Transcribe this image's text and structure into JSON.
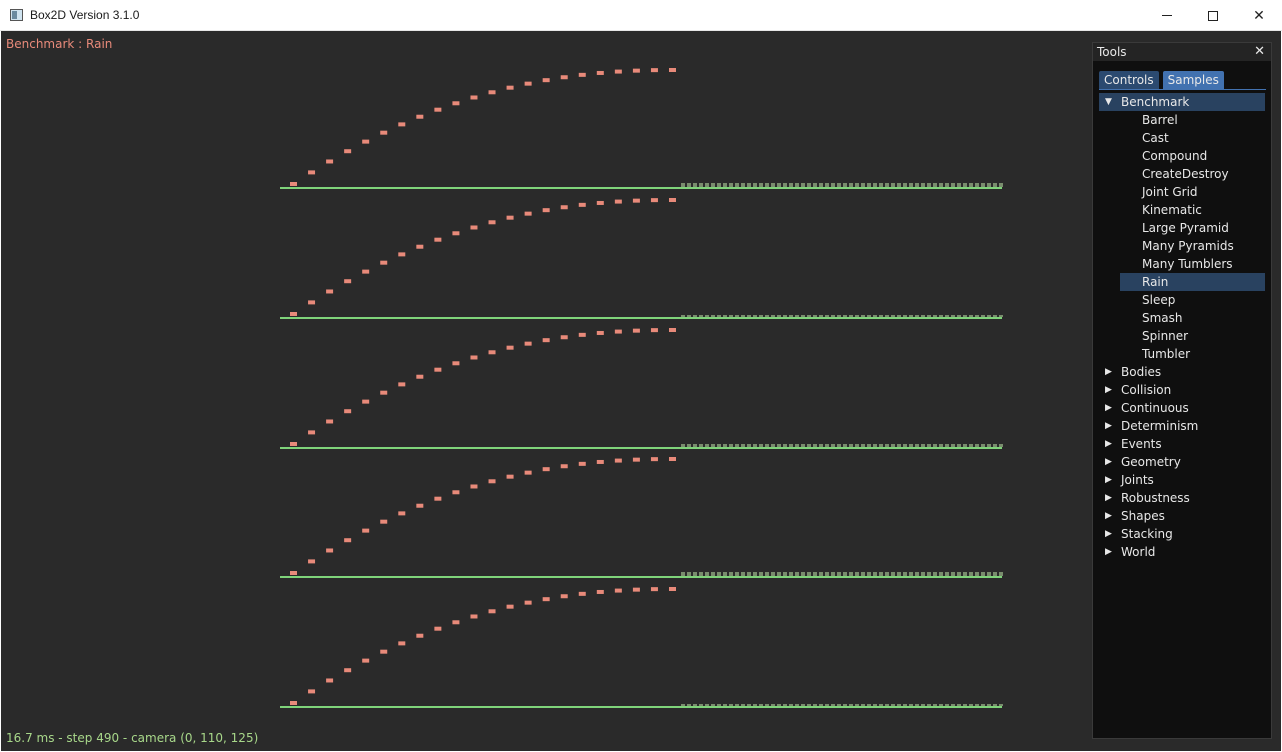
{
  "window": {
    "title": "Box2D Version 3.1.0",
    "minimize_label": "",
    "maximize_label": "",
    "close_label": "✕"
  },
  "viewport": {
    "sample_title": "Benchmark : Rain",
    "status": "16.7 ms - step 490 - camera (0, 110, 125)",
    "colors": {
      "background": "#2a2a2a",
      "ground": "#7fd37a",
      "body": "#e88a7a",
      "title": "#e88a7a",
      "status": "#a8d88a"
    }
  },
  "tools": {
    "title": "Tools",
    "close_label": "✕",
    "tabs": [
      {
        "label": "Controls",
        "active": false
      },
      {
        "label": "Samples",
        "active": true
      }
    ],
    "tree": [
      {
        "label": "Benchmark",
        "expanded": true,
        "selected": true,
        "children": [
          {
            "label": "Barrel"
          },
          {
            "label": "Cast"
          },
          {
            "label": "Compound"
          },
          {
            "label": "CreateDestroy"
          },
          {
            "label": "Joint Grid"
          },
          {
            "label": "Kinematic"
          },
          {
            "label": "Large Pyramid"
          },
          {
            "label": "Many Pyramids"
          },
          {
            "label": "Many Tumblers"
          },
          {
            "label": "Rain",
            "selected": true
          },
          {
            "label": "Sleep"
          },
          {
            "label": "Smash"
          },
          {
            "label": "Spinner"
          },
          {
            "label": "Tumbler"
          }
        ]
      },
      {
        "label": "Bodies",
        "expanded": false
      },
      {
        "label": "Collision",
        "expanded": false
      },
      {
        "label": "Continuous",
        "expanded": false
      },
      {
        "label": "Determinism",
        "expanded": false
      },
      {
        "label": "Events",
        "expanded": false
      },
      {
        "label": "Geometry",
        "expanded": false
      },
      {
        "label": "Joints",
        "expanded": false
      },
      {
        "label": "Robustness",
        "expanded": false
      },
      {
        "label": "Shapes",
        "expanded": false
      },
      {
        "label": "Stacking",
        "expanded": false
      },
      {
        "label": "World",
        "expanded": false
      }
    ]
  }
}
